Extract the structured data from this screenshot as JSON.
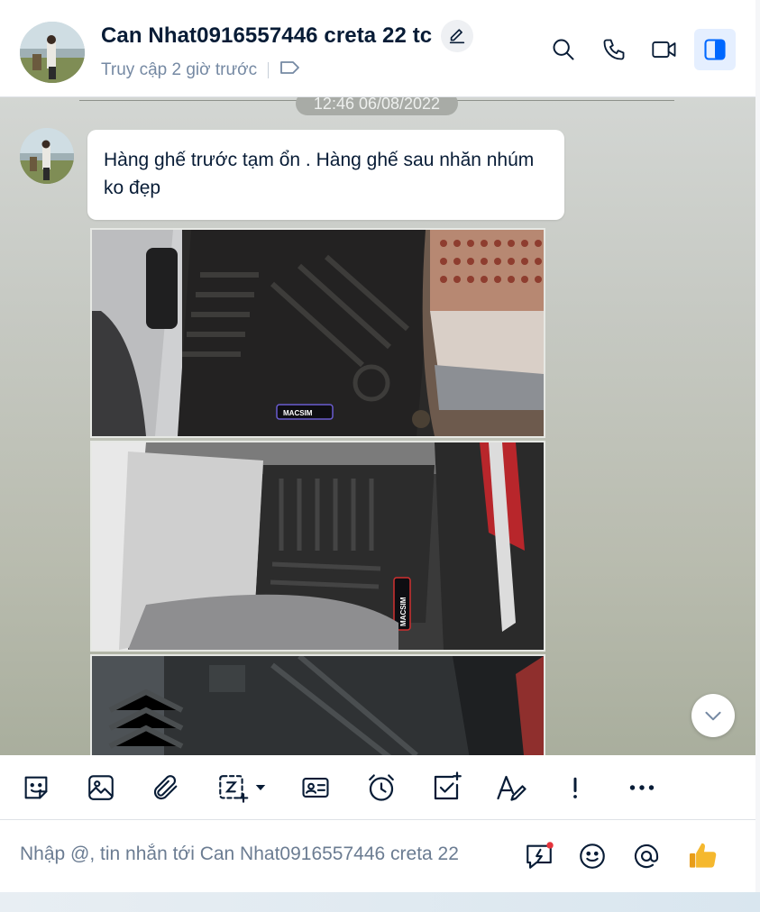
{
  "header": {
    "contact_name": "Can Nhat0916557446 creta 22 tc",
    "last_seen": "Truy cập 2 giờ trước",
    "icons": [
      "edit-icon",
      "tag-icon",
      "search-icon",
      "phone-icon",
      "video-icon",
      "sidebar-toggle-icon"
    ]
  },
  "chat": {
    "timestamp": "12:46 06/08/2022",
    "message_text": "Hàng ghế trước tạm ổn . Hàng ghế  sau nhăn nhúm ko đẹp",
    "photo1_brand": "MACSIM",
    "photo2_brand": "MACSIM"
  },
  "toolbar": {
    "icons": [
      "sticker-icon",
      "image-icon",
      "attachment-icon",
      "screenshot-icon",
      "contact-card-icon",
      "reminder-icon",
      "todo-icon",
      "text-format-icon",
      "urgent-icon",
      "more-icon"
    ]
  },
  "composer": {
    "placeholder": "Nhập @, tin nhắn tới Can Nhat0916557446 creta 22",
    "icons": [
      "quick-message-icon",
      "emoji-icon",
      "mention-icon",
      "thumbs-up-icon"
    ]
  },
  "colors": {
    "accent": "#0068ff",
    "active_bg": "#e5efff",
    "text_primary": "#081c36",
    "text_secondary": "#7589a3"
  }
}
